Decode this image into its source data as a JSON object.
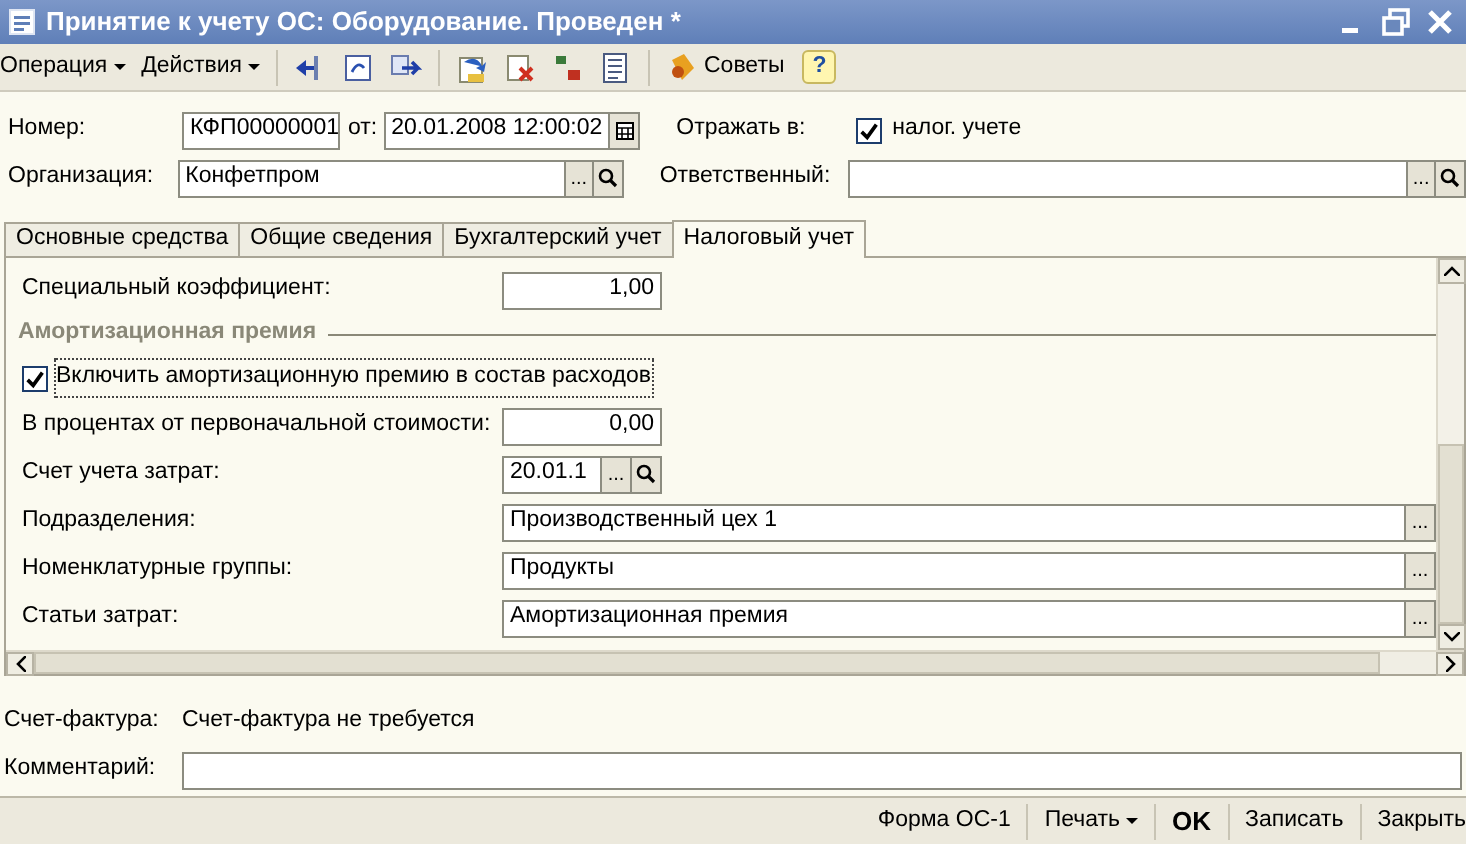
{
  "window": {
    "title": "Принятие к учету ОС: Оборудование. Проведен *"
  },
  "toolbar": {
    "menus": [
      "Операция",
      "Действия"
    ],
    "tips": "Советы",
    "help": "?"
  },
  "header": {
    "number_label": "Номер:",
    "number": "КФП00000001",
    "date_label": "от:",
    "date": "20.01.2008 12:00:02",
    "reflect_label": "Отражать в:",
    "reflect_checkbox": {
      "label": "налог. учете",
      "checked": true
    },
    "org_label": "Организация:",
    "org": "Конфетпром",
    "org_select": "...",
    "responsible_label": "Ответственный:",
    "responsible_select": "..."
  },
  "tabs": [
    {
      "label": "Основные средства",
      "selected": false
    },
    {
      "label": "Общие сведения",
      "selected": false
    },
    {
      "label": "Бухгалтерский учет",
      "selected": false
    },
    {
      "label": "Налоговый учет",
      "selected": true
    }
  ],
  "tax_rows": [
    {
      "kind": "number",
      "label": "Специальный коэффициент:",
      "value": "1,00"
    },
    {
      "kind": "section",
      "label": "Амортизационная премия"
    },
    {
      "kind": "checkbox",
      "label": "Включить амортизационную премию в состав расходов",
      "checked": true
    },
    {
      "kind": "number",
      "label": "В процентах от первоначальной стоимости:",
      "value": "0,00"
    },
    {
      "kind": "account",
      "label": "Счет учета затрат:",
      "value": "20.01.1",
      "select": "..."
    },
    {
      "kind": "reference",
      "label": "Подразделения:",
      "value": "Производственный цех 1",
      "select": "..."
    },
    {
      "kind": "reference",
      "label": "Номенклатурные группы:",
      "value": "Продукты",
      "select": "..."
    },
    {
      "kind": "reference",
      "label": "Статьи затрат:",
      "value": "Амортизационная премия",
      "select": "..."
    }
  ],
  "invoice": {
    "label": "Счет-фактура:",
    "value": "Счет-фактура не требуется"
  },
  "comment": {
    "label": "Комментарий:"
  },
  "footer_buttons": [
    {
      "kind": "plain",
      "label": "Форма ОС-1"
    },
    {
      "kind": "menu",
      "label": "Печать"
    },
    {
      "kind": "default",
      "label": "OK"
    },
    {
      "kind": "plain",
      "label": "Записать"
    },
    {
      "kind": "plain",
      "label": "Закрыть"
    }
  ]
}
